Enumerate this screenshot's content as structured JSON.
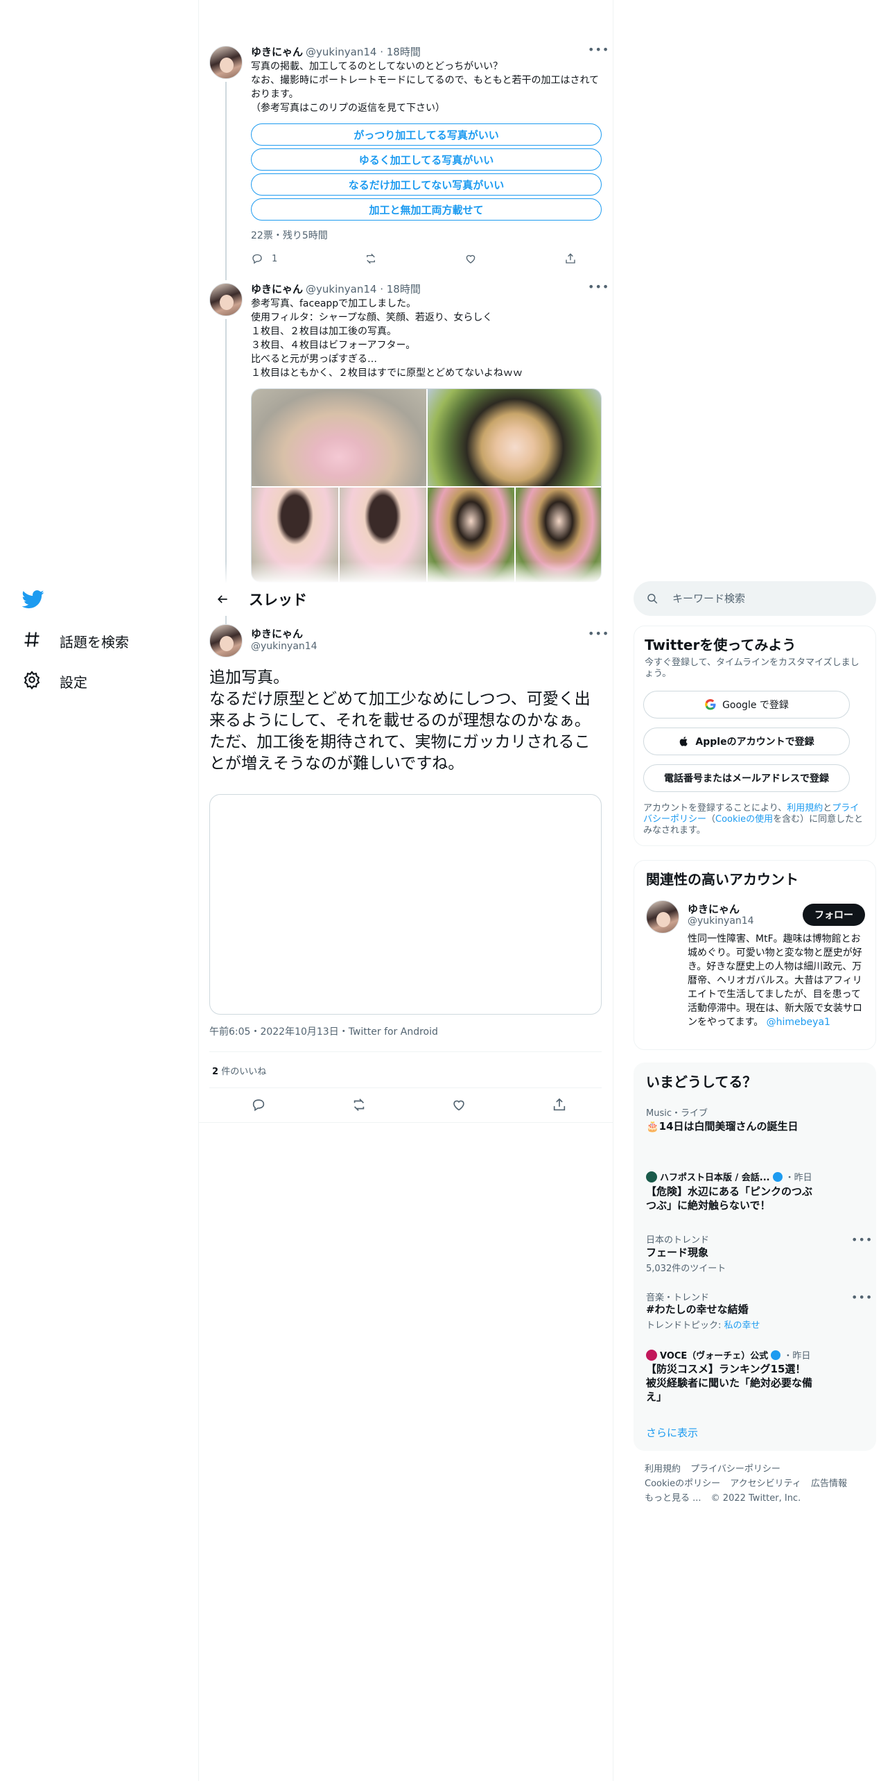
{
  "nav": {
    "items": [
      {
        "label": "話題を検索",
        "icon": "hashtag-icon"
      },
      {
        "label": "設定",
        "icon": "gear-icon"
      }
    ]
  },
  "tweets": [
    {
      "name": "ゆきにゃん",
      "meta": "@yukinyan14 · 18時間",
      "text": "写真の掲載、加工してるのとしてないのとどっちがいい？\nなお、撮影時にポートレートモードにしてるので、もともと若干の加工はされております。\n（参考写真はこのリプの返信を見て下さい）",
      "poll_options": [
        "がっつり加工してる写真がいい",
        "ゆるく加工してる写真がいい",
        "なるだけ加工してない写真がいい",
        "加工と無加工両方載せて"
      ],
      "poll_status": "22票・残り5時間",
      "reply_count": "1"
    },
    {
      "name": "ゆきにゃん",
      "meta": "@yukinyan14 · 18時間",
      "text": "参考写真、faceappで加工しました。\n使用フィルタ：シャープな顔、笑顔、若返り、女らしく\n１枚目、２枚目は加工後の写真。\n３枚目、４枚目はビフォーアフター。\n比べると元が男っぽすぎる…\n１枚目はともかく、２枚目はすでに原型とどめてないよねｗｗ"
    }
  ],
  "header": {
    "title": "スレッド"
  },
  "main_tweet": {
    "name": "ゆきにゃん",
    "handle": "@yukinyan14",
    "text": "追加写真。\nなるだけ原型とどめて加工少なめにしつつ、可愛く出来るようにして、それを載せるのが理想なのかなぁ。\nただ、加工後を期待されて、実物にガッカリされることが増えそうなのが難しいですね。",
    "timestamp": "午前6:05・2022年10月13日・Twitter for Android",
    "likes_count": "2",
    "likes_label": "件のいいね"
  },
  "search": {
    "placeholder": "キーワード検索"
  },
  "signup": {
    "title": "Twitterを使ってみよう",
    "subtitle": "今すぐ登録して、タイムラインをカスタマイズしましょう。",
    "google_label": "Google で登録",
    "apple_label": "Appleのアカウントで登録",
    "phone_label": "電話番号またはメールアドレスで登録",
    "terms_prefix": "アカウントを登録することにより、",
    "terms_link": "利用規約",
    "terms_and": "と",
    "privacy_link": "プライバシーポリシー",
    "cookie_open": "（",
    "cookie_link": "Cookieの使用",
    "terms_suffix": "を含む）に同意したとみなされます。"
  },
  "related": {
    "title": "関連性の高いアカウント",
    "name": "ゆきにゃん",
    "handle": "@yukinyan14",
    "follow_label": "フォロー",
    "bio": "性同一性障害、MtF。趣味は博物館とお城めぐり。可愛い物と変な物と歴史が好き。好きな歴史上の人物は細川政元、万暦帝、ヘリオガバルス。大昔はアフィリエイトで生活してましたが、目を患って活動停滞中。現在は、新大阪で女装サロンをやってます。",
    "bio_link": "@himebeya1"
  },
  "trends": {
    "title": "いまどうしてる？",
    "items": [
      {
        "category": "Music・ライブ",
        "title": "🎂14日は白間美瑠さんの誕生日"
      },
      {
        "category": "ハフポスト日本版 / 会話...",
        "time": "・昨日",
        "title": "【危険】水辺にある「ピンクのつぶつぶ」に絶対触らないで！"
      },
      {
        "category": "日本のトレンド",
        "title": "フェード現象",
        "sub": "5,032件のツイート"
      },
      {
        "category": "音楽・トレンド",
        "title": "#わたしの幸せな結婚",
        "sub_prefix": "トレンドトピック: ",
        "sub_link": "私の幸せ"
      },
      {
        "category": "VOCE（ヴォーチェ）公式",
        "time": "・昨日",
        "title": "【防災コスメ】ランキング15選！被災経験者に聞いた「絶対必要な備え」"
      }
    ],
    "show_more": "さらに表示"
  },
  "footer": {
    "links": [
      "利用規約",
      "プライバシーポリシー",
      "Cookieのポリシー",
      "アクセシビリティ",
      "広告情報",
      "もっと見る ..."
    ],
    "copyright": "© 2022 Twitter, Inc."
  },
  "colors": {
    "accent": "#1d9bf0",
    "text": "#0f1419",
    "muted": "#536471",
    "border": "#eff3f4"
  }
}
